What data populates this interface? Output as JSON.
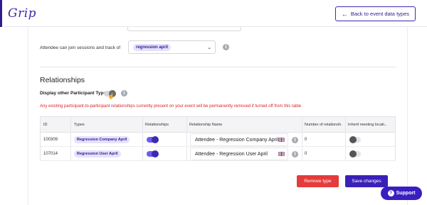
{
  "header": {
    "logo": "Grip",
    "back_button": "Back to event data types",
    "back_icon": "arrow-left-icon"
  },
  "attendee_field": {
    "label": "Attendee can join sessions and track of",
    "selected": "regression april"
  },
  "relationships": {
    "title": "Relationships",
    "display_label": "Display other Participant Types",
    "display_toggle": "off",
    "warning": "Any existing participant-to-participant relationships currently present on your event will be permanently removed if turned off from this table"
  },
  "table": {
    "columns": [
      "ID",
      "Types",
      "Relationships",
      "Relationship Name",
      "Number of relationsh...",
      "Inherit meeting locati..."
    ],
    "rows": [
      {
        "id": "100309",
        "type": "Regression Company April",
        "relationships": "on",
        "name": "Attendee - Regression Company April",
        "count": "0",
        "inherit": "off"
      },
      {
        "id": "107014",
        "type": "Regression User April",
        "relationships": "on",
        "name": "Attendee - Regression User April",
        "count": "0",
        "inherit": "off"
      }
    ]
  },
  "actions": {
    "remove": "Remove type",
    "save": "Save changes"
  },
  "support": {
    "label": "Support"
  },
  "colors": {
    "brand": "#3a2bb0",
    "danger": "#e43b3b",
    "chip_bg": "#e6e1fb"
  }
}
